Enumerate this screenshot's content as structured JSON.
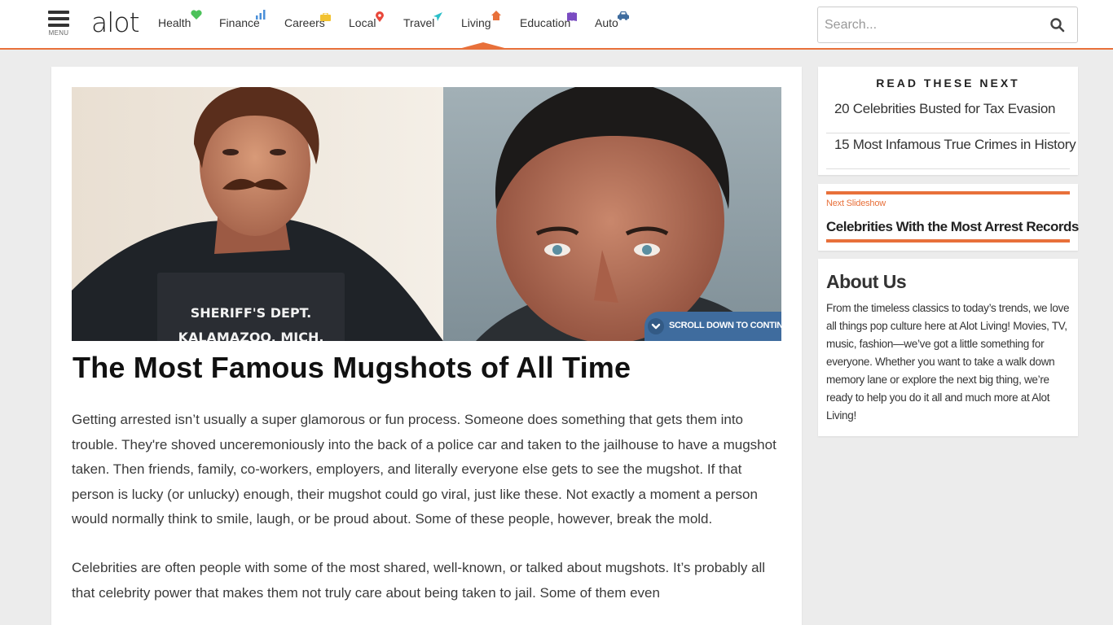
{
  "header": {
    "menu_label": "MENU",
    "logo": "alot",
    "nav": [
      {
        "label": "Health",
        "icon": "heart-icon",
        "color": "#4cc25a"
      },
      {
        "label": "Finance",
        "icon": "bar-chart-icon",
        "color": "#4a8fd8"
      },
      {
        "label": "Careers",
        "icon": "briefcase-icon",
        "color": "#f2c230"
      },
      {
        "label": "Local",
        "icon": "map-pin-icon",
        "color": "#e8473a"
      },
      {
        "label": "Travel",
        "icon": "airplane-icon",
        "color": "#2bbfc9"
      },
      {
        "label": "Living",
        "icon": "home-icon",
        "color": "#e8703a"
      },
      {
        "label": "Education",
        "icon": "book-icon",
        "color": "#7a4cc2"
      },
      {
        "label": "Auto",
        "icon": "car-icon",
        "color": "#3f6c9e"
      }
    ],
    "active_nav": "Living",
    "search": {
      "placeholder": "Search..."
    }
  },
  "article": {
    "scroll_badge": "SCROLL DOWN TO CONTINUE",
    "mugshot_placard_line1": "SHERIFF'S DEPT.",
    "mugshot_placard_line2": "KALAMAZOO, MICH.",
    "title": "The Most Famous Mugshots of All Time",
    "paragraphs": [
      "Getting arrested isn’t usually a super glamorous or fun process. Someone does something that gets them into trouble. They're shoved unceremoniously into the back of a police car and taken to the jailhouse to have a mugshot taken. Then friends, family, co-workers, employers, and literally everyone else gets to see the mugshot. If that person is lucky (or unlucky) enough, their mugshot could go viral, just like these. Not exactly a moment a person would normally think to smile, laugh, or be proud about. Some of these people, however, break the mold.",
      "Celebrities are often people with some of the most shared, well-known, or talked about mugshots. It’s probably all that celebrity power that makes them not truly care about being taken to jail. Some of them even"
    ]
  },
  "sidebar": {
    "read_next": {
      "title": "READ THESE NEXT",
      "items": [
        "20 Celebrities Busted for Tax Evasion",
        "15 Most Infamous True Crimes in History"
      ]
    },
    "next_slideshow": {
      "label": "Next Slideshow",
      "title": "Celebrities With the Most Arrest Records"
    },
    "about": {
      "title": "About Us",
      "text": "From the timeless classics to today’s trends, we love all things pop culture here at Alot Living! Movies, TV, music, fashion—we’ve got a little something for everyone. Whether you want to take a walk down memory lane or explore the next big thing, we’re ready to help you do it all and much more at Alot Living!"
    }
  },
  "colors": {
    "accent": "#e8703a",
    "badge": "#3f6c9e"
  }
}
